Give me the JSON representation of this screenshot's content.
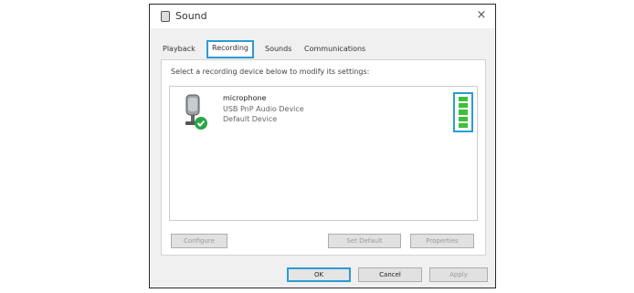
{
  "window": {
    "title": "Sound",
    "close_symbol": "×"
  },
  "tabs": [
    {
      "label": "Playback",
      "active": false
    },
    {
      "label": "Recording",
      "active": true
    },
    {
      "label": "Sounds",
      "active": false
    },
    {
      "label": "Communications",
      "active": false
    }
  ],
  "recording": {
    "instruction": "Select a recording device below to modify its settings:",
    "devices": [
      {
        "name": "microphone",
        "description": "USB PnP Audio Device",
        "status": "Default Device",
        "icon": "microphone-icon",
        "badge": "default-check-icon"
      }
    ],
    "configure_label": "Configure",
    "set_default_label": "Set Default",
    "properties_label": "Properties"
  },
  "footer": {
    "ok_label": "OK",
    "cancel_label": "Cancel",
    "apply_label": "Apply"
  },
  "colors": {
    "highlight": "#2b9bd6",
    "level_meter": "#3cc13c",
    "check_badge": "#27a844"
  }
}
